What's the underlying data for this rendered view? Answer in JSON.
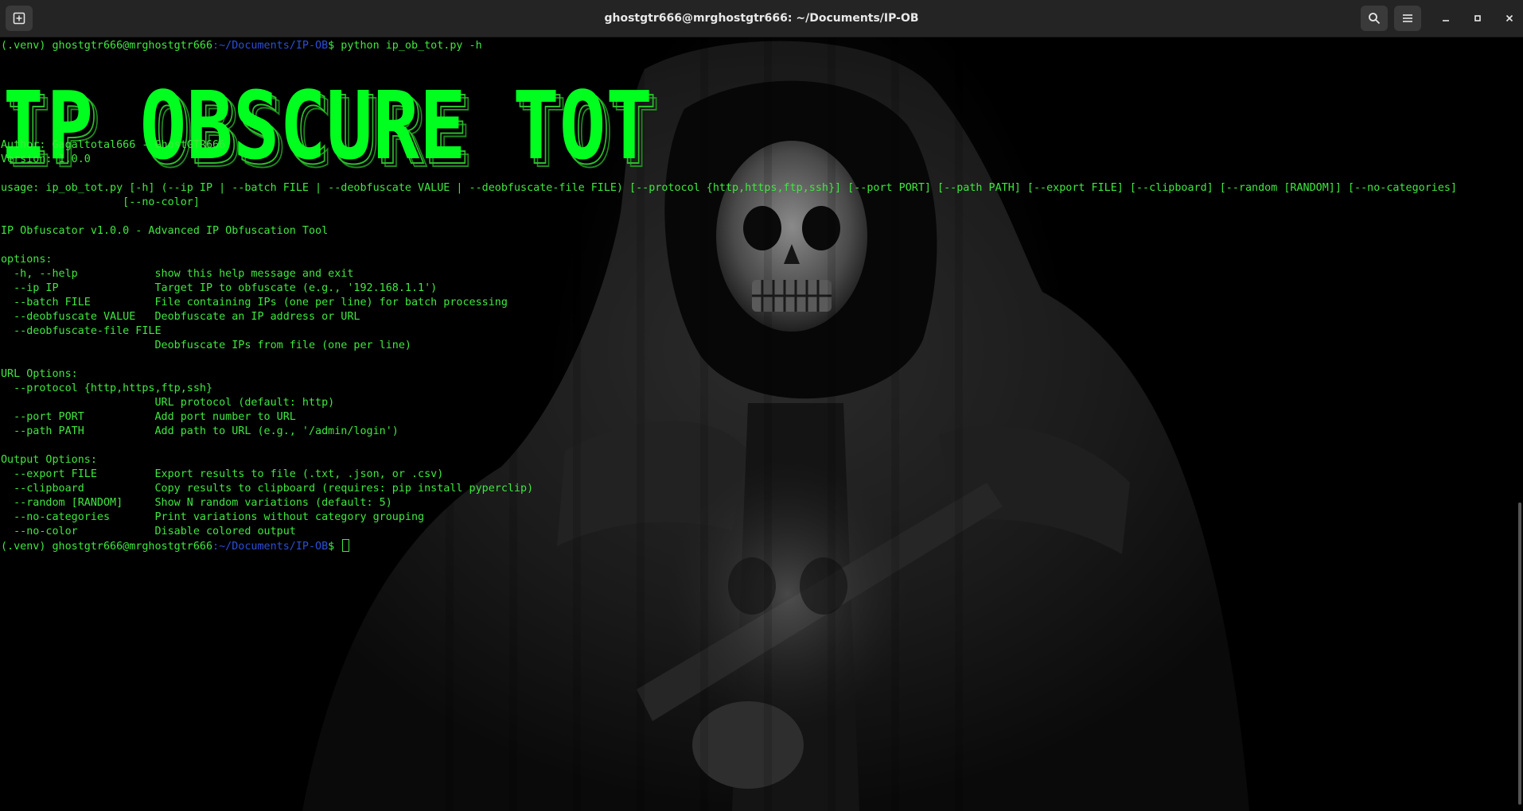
{
  "window": {
    "title": "ghostgtr666@mrghostgtr666: ~/Documents/IP-OB"
  },
  "prompt": {
    "env": "(.venv) ",
    "user_host": "ghostgtr666@mrghostgtr666",
    "path": ":~/Documents/IP-OB",
    "symbol": "$ "
  },
  "command": "python ip_ob_tot.py -h",
  "banner": "IP OBSCURE TOT",
  "output": [
    "Author: Gagaltotal666 - GhostGTR666",
    "Version: 1.0.0",
    "",
    "usage: ip_ob_tot.py [-h] (--ip IP | --batch FILE | --deobfuscate VALUE | --deobfuscate-file FILE) [--protocol {http,https,ftp,ssh}] [--port PORT] [--path PATH] [--export FILE] [--clipboard] [--random [RANDOM]] [--no-categories]",
    "                   [--no-color]",
    "",
    "IP Obfuscator v1.0.0 - Advanced IP Obfuscation Tool",
    "",
    "options:",
    "  -h, --help            show this help message and exit",
    "  --ip IP               Target IP to obfuscate (e.g., '192.168.1.1')",
    "  --batch FILE          File containing IPs (one per line) for batch processing",
    "  --deobfuscate VALUE   Deobfuscate an IP address or URL",
    "  --deobfuscate-file FILE",
    "                        Deobfuscate IPs from file (one per line)",
    "",
    "URL Options:",
    "  --protocol {http,https,ftp,ssh}",
    "                        URL protocol (default: http)",
    "  --port PORT           Add port number to URL",
    "  --path PATH           Add path to URL (e.g., '/admin/login')",
    "",
    "Output Options:",
    "  --export FILE         Export results to file (.txt, .json, or .csv)",
    "  --clipboard           Copy results to clipboard (requires: pip install pyperclip)",
    "  --random [RANDOM]     Show N random variations (default: 5)",
    "  --no-categories       Print variations without category grouping",
    "  --no-color            Disable colored output"
  ],
  "colors": {
    "terminal_text": "#3ee83e",
    "prompt_path": "#2a4fd6",
    "titlebar_bg": "#242424",
    "background": "#000000"
  },
  "icons": {
    "new_tab": "new-tab-icon",
    "search": "search-icon",
    "menu": "hamburger-menu-icon",
    "minimize": "minimize-icon",
    "maximize": "maximize-icon",
    "close": "close-icon"
  }
}
